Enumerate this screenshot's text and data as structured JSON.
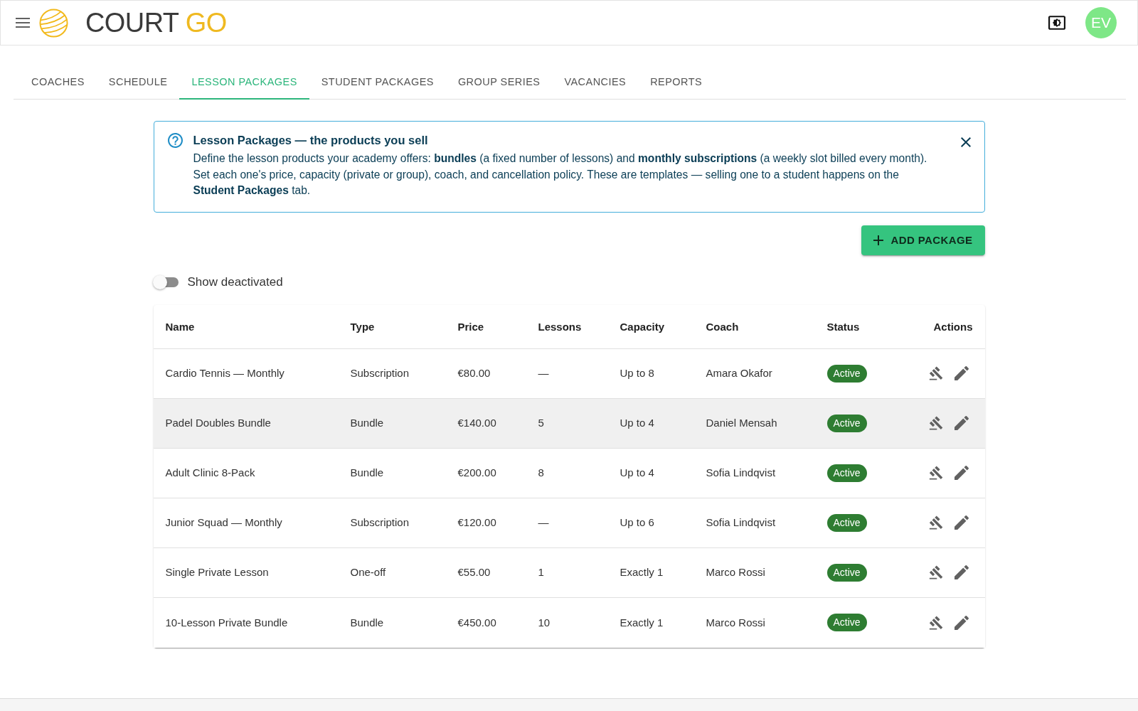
{
  "header": {
    "logo": {
      "text": "COURT",
      "accent": "GO"
    },
    "avatar": {
      "initials": "EV"
    }
  },
  "tabs": [
    {
      "label": "COACHES",
      "selected": false
    },
    {
      "label": "SCHEDULE",
      "selected": false
    },
    {
      "label": "LESSON PACKAGES",
      "selected": true
    },
    {
      "label": "STUDENT PACKAGES",
      "selected": false
    },
    {
      "label": "GROUP SERIES",
      "selected": false
    },
    {
      "label": "VACANCIES",
      "selected": false
    },
    {
      "label": "REPORTS",
      "selected": false
    }
  ],
  "banner": {
    "title": "Lesson Packages — the products you sell",
    "body": "Define the lesson products your academy offers: **bundles** (a fixed number of lessons) and **monthly subscriptions** (a weekly slot billed every month). Set each one's price, capacity (private or group), coach, and cancellation policy. These are templates — selling one to a student happens on the **Student Packages** tab."
  },
  "add_button": {
    "label": "ADD PACKAGE"
  },
  "toggle": {
    "label": "Show deactivated",
    "on": false
  },
  "table": {
    "columns": [
      "Name",
      "Type",
      "Price",
      "Lessons",
      "Capacity",
      "Coach",
      "Status",
      "Actions"
    ],
    "rows": [
      {
        "name": "Cardio Tennis — Monthly",
        "type": "Subscription",
        "price": "€80.00",
        "lessons": "—",
        "capacity": "Up to 8",
        "coach": "Amara Okafor",
        "status": "Active",
        "highlighted": false
      },
      {
        "name": "Padel Doubles Bundle",
        "type": "Bundle",
        "price": "€140.00",
        "lessons": "5",
        "capacity": "Up to 4",
        "coach": "Daniel Mensah",
        "status": "Active",
        "highlighted": true
      },
      {
        "name": "Adult Clinic 8-Pack",
        "type": "Bundle",
        "price": "€200.00",
        "lessons": "8",
        "capacity": "Up to 4",
        "coach": "Sofia Lindqvist",
        "status": "Active",
        "highlighted": false
      },
      {
        "name": "Junior Squad — Monthly",
        "type": "Subscription",
        "price": "€120.00",
        "lessons": "—",
        "capacity": "Up to 6",
        "coach": "Sofia Lindqvist",
        "status": "Active",
        "highlighted": false
      },
      {
        "name": "Single Private Lesson",
        "type": "One-off",
        "price": "€55.00",
        "lessons": "1",
        "capacity": "Exactly 1",
        "coach": "Marco Rossi",
        "status": "Active",
        "highlighted": false
      },
      {
        "name": "10-Lesson Private Bundle",
        "type": "Bundle",
        "price": "€450.00",
        "lessons": "10",
        "capacity": "Exactly 1",
        "coach": "Marco Rossi",
        "status": "Active",
        "highlighted": false
      }
    ]
  }
}
